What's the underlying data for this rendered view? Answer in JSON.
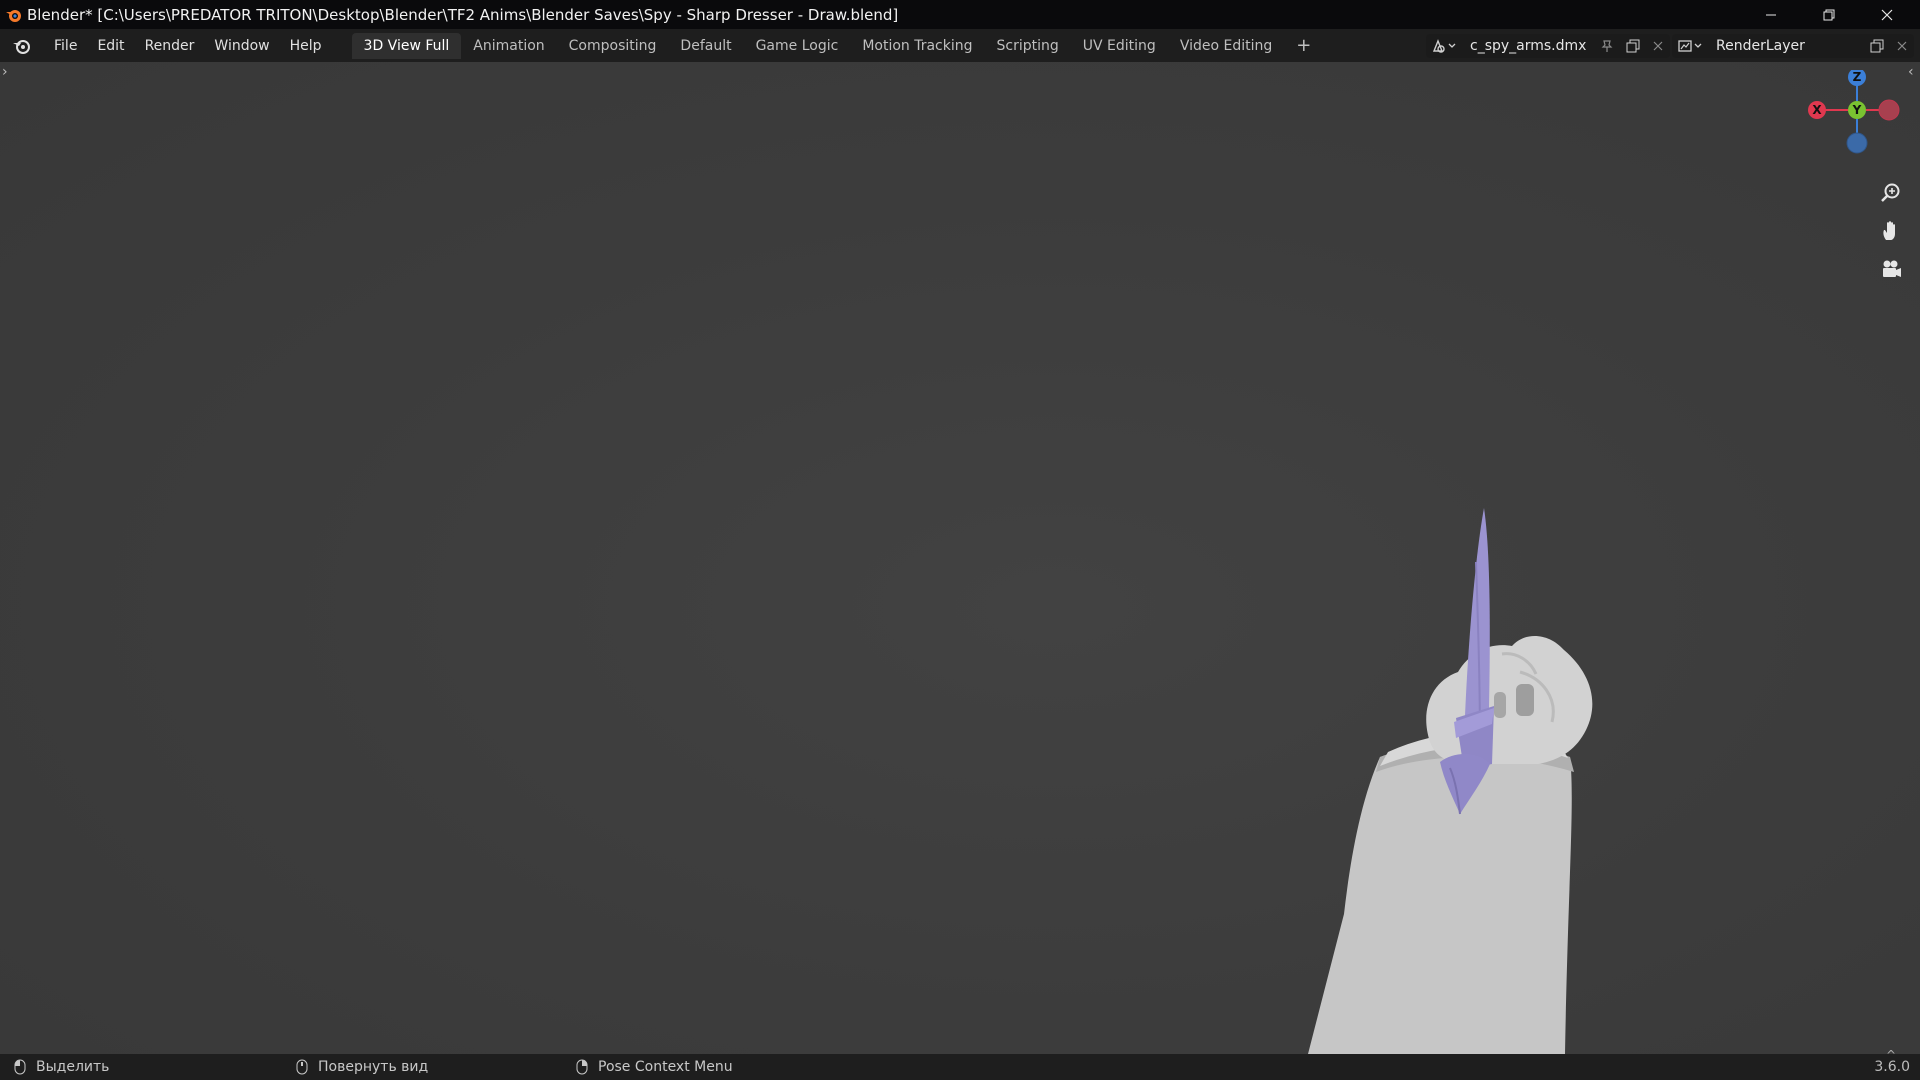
{
  "window": {
    "title": "Blender* [C:\\Users\\PREDATOR TRITON\\Desktop\\Blender\\TF2 Anims\\Blender Saves\\Spy - Sharp Dresser - Draw.blend]"
  },
  "menu": {
    "items": [
      "File",
      "Edit",
      "Render",
      "Window",
      "Help"
    ]
  },
  "workspaces": {
    "tabs": [
      "3D View Full",
      "Animation",
      "Compositing",
      "Default",
      "Game Logic",
      "Motion Tracking",
      "Scripting",
      "UV Editing",
      "Video Editing"
    ],
    "active": "3D View Full",
    "add_label": "+"
  },
  "scene": {
    "name": "c_spy_arms.dmx"
  },
  "view_layer": {
    "name": "RenderLayer"
  },
  "gizmo": {
    "z_label": "Z",
    "y_label": "Y",
    "x_label": "X",
    "colors": {
      "x": "#e0384f",
      "y": "#7ac231",
      "z": "#3b7fd8"
    }
  },
  "status": {
    "left_action": "Выделить",
    "middle_action": "Повернуть вид",
    "right_action": "Pose Context Menu",
    "version": "3.6.0"
  },
  "icons": [
    "blender-logo-icon",
    "minimize-icon",
    "restore-icon",
    "close-icon",
    "scene-icon",
    "pin-icon",
    "duplicate-icon",
    "view-layer-icon",
    "zoom-icon",
    "hand-pan-icon",
    "camera-icon",
    "mouse-left-icon",
    "mouse-middle-icon",
    "mouse-right-icon"
  ],
  "colors": {
    "accent": "#4772b3",
    "knife": "#9b93d0",
    "arm": "#c8c8c8"
  }
}
